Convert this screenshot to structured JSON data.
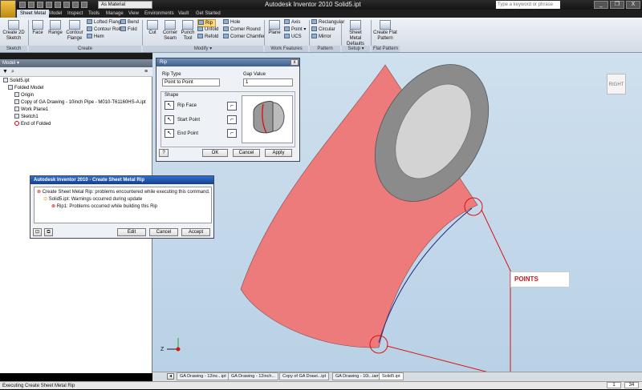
{
  "titlebar": {
    "title": "Autodesk Inventor 2010   Solid5.ipt",
    "material": "As Material",
    "search_placeholder": "Type a keyword or phrase",
    "win_minimize": "_",
    "win_restore": "❐",
    "win_close": "X"
  },
  "tabs": [
    "Sheet Metal",
    "Model",
    "Inspect",
    "Tools",
    "Manage",
    "View",
    "Environments",
    "Vault",
    "Get Started"
  ],
  "ribbon": {
    "sketch": {
      "create_2d_sketch": "Create 2D Sketch",
      "panel": "Sketch"
    },
    "create": {
      "face": "Face",
      "range": "Range",
      "contour_flange": "Contour Flange",
      "lofted_flange": "Lofted Flange",
      "contour_roll": "Contour Roll",
      "hem": "Hem",
      "bend": "Bend",
      "fold": "Fold",
      "panel": "Create"
    },
    "modify": {
      "cut": "Cut",
      "corner_seam": "Corner Seam",
      "punch_tool": "Punch Tool",
      "rip": "Rip",
      "unfold": "Unfold",
      "refold": "Refold",
      "hole": "Hole",
      "corner_round": "Corner Round",
      "corner_chamfer": "Corner Chamfer",
      "panel": "Modify ▾"
    },
    "work_features": {
      "plane": "Plane",
      "axis": "Axis",
      "point": "Point ▾",
      "ucs": "UCS",
      "panel": "Work Features"
    },
    "pattern": {
      "rectangular": "Rectangular",
      "circular": "Circular",
      "mirror": "Mirror",
      "panel": "Pattern"
    },
    "setup": {
      "sheet_metal_defaults": "Sheet Metal Defaults",
      "panel": "Setup ▾"
    },
    "flat_pattern": {
      "create_flat_pattern": "Create Flat Pattern",
      "panel": "Flat Pattern"
    }
  },
  "browser": {
    "title": "Model ▾",
    "items": [
      "Solid5.ipt",
      "Folded Model",
      "Origin",
      "Copy of GA  Drawing - 10inch Pipe - M010-T61160HS-A.ipt",
      "Work Plane1",
      "Sketch1",
      "End of Folded"
    ]
  },
  "rip_dialog": {
    "title": "Rip",
    "rip_type_label": "Rip Type",
    "rip_type_value": "Point to Point",
    "gap_label": "Gap Value",
    "gap_value": "1",
    "shape_label": "Shape",
    "rip_face": "Rip Face",
    "start_point": "Start Point",
    "end_point": "End Point",
    "ok": "OK",
    "cancel": "Cancel",
    "apply": "Apply"
  },
  "error_dialog": {
    "title": "Autodesk Inventor 2010 - Create Sheet Metal Rip",
    "line1": "Create Sheet Metal Rip: problems encountered while executing this command.",
    "line2": "Solid5.ipt: Warnings occurred during update",
    "line3": "Rip1: Problems occurred while building this Rip",
    "edit": "Edit",
    "cancel": "Cancel",
    "accept": "Accept"
  },
  "viewport": {
    "viewcube": "RIGHT",
    "annotation": "POINTS",
    "accent_pipe": "#ee7b7b"
  },
  "doc_tabs": [
    "GA  Drawing - 12inc...ipt",
    "GA  Drawing - 12inch...",
    "Copy of GA  Drawi...ipt",
    "GA  Drawing - 10i...iam",
    "Solid5.ipt"
  ],
  "status": {
    "text": "Executing Create Sheet Metal Rip",
    "num1": "1",
    "num2": "34"
  }
}
